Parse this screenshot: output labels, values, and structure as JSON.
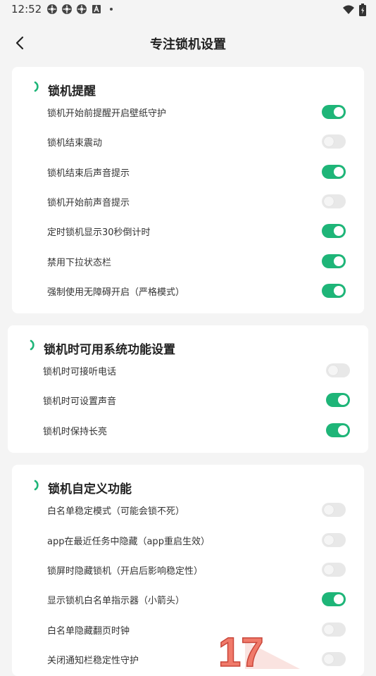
{
  "status": {
    "time": "12:52",
    "left_icons": [
      "settings-gear-icon",
      "settings-gear-icon",
      "settings-gear-icon",
      "font-icon",
      "dot-icon"
    ],
    "right_icons": [
      "wifi-icon",
      "battery-icon"
    ]
  },
  "header": {
    "title": "专注锁机设置",
    "back_icon": "chevron-left-icon"
  },
  "accent_color": "#1eb578",
  "sections": [
    {
      "title": "锁机提醒",
      "items": [
        {
          "label": "锁机开始前提醒开启壁纸守护",
          "on": true
        },
        {
          "label": "锁机结束震动",
          "on": false
        },
        {
          "label": "锁机结束后声音提示",
          "on": true
        },
        {
          "label": "锁机开始前声音提示",
          "on": false
        },
        {
          "label": "定时锁机显示30秒倒计时",
          "on": true
        },
        {
          "label": "禁用下拉状态栏",
          "on": true
        },
        {
          "label": "强制使用无障碍开启（严格模式）",
          "on": true
        }
      ]
    },
    {
      "title": "锁机时可用系统功能设置",
      "items": [
        {
          "label": "锁机时可接听电话",
          "on": false
        },
        {
          "label": "锁机时可设置声音",
          "on": true
        },
        {
          "label": "锁机时保持长亮",
          "on": true
        }
      ]
    },
    {
      "title": "锁机自定义功能",
      "items": [
        {
          "label": "白名单稳定模式（可能会锁不死）",
          "on": false
        },
        {
          "label": "app在最近任务中隐藏（app重启生效）",
          "on": false
        },
        {
          "label": "锁屏时隐藏锁机（开启后影响稳定性）",
          "on": false
        },
        {
          "label": "显示锁机白名单指示器（小箭头）",
          "on": true
        },
        {
          "label": "白名单隐藏翻页时钟",
          "on": false
        },
        {
          "label": "关闭通知栏稳定性守护",
          "on": false
        }
      ]
    }
  ],
  "watermark": {
    "text": "17"
  }
}
